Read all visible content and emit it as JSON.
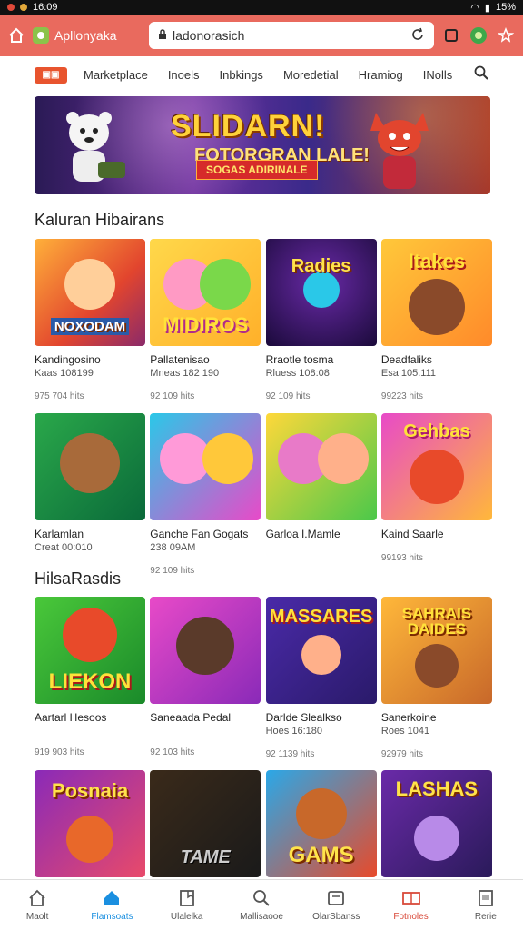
{
  "statusbar": {
    "time": "16:09",
    "battery": "15%"
  },
  "browser": {
    "app_name": "Apllonyaka",
    "url": "ladonorasich"
  },
  "nav": {
    "items": [
      "Marketplace",
      "Inoels",
      "Inbkings",
      "Moredetial",
      "Hramiog",
      "INolls"
    ]
  },
  "banner": {
    "title": "SLIDARN!",
    "subtitle": "FOTORGRAN LALE!",
    "tag": "SOGAS ADIRINALE"
  },
  "sections": [
    {
      "title": "Kaluran Hibairans",
      "cards": [
        {
          "art": "NOXODAM",
          "name": "Kandingosino",
          "meta": "Kaas 108199",
          "stat": "975 704 hits"
        },
        {
          "art": "MIDIROS",
          "name": "Pallatenisao",
          "meta": "Mneas 182 190",
          "stat": "92 109 hits"
        },
        {
          "art": "Radies",
          "name": "Rraotle tosma",
          "meta": "Rluess 108:08",
          "stat": "92 109 hits"
        },
        {
          "art": "Itakes",
          "name": "Deadfaliks",
          "meta": "Esa 105.111",
          "stat": "99223 hits"
        },
        {
          "art": "",
          "name": "Karlamlan",
          "meta": "Creat 00:010",
          "stat": ""
        },
        {
          "art": "",
          "name": "Ganche Fan Gogats",
          "meta": "238 09AM",
          "stat": "92 109 hits"
        },
        {
          "art": "",
          "name": "Garloa I.Mamle",
          "meta": "",
          "stat": ""
        },
        {
          "art": "Gehbas",
          "name": "Kaind Saarle",
          "meta": "",
          "stat": "99193 hits"
        }
      ]
    },
    {
      "title": "HilsaRasdis",
      "cards": [
        {
          "art": "LIEKON",
          "name": "Aartarl Hesoos",
          "meta": "",
          "stat": "919 903 hits"
        },
        {
          "art": "",
          "name": "Saneaada Pedal",
          "meta": "",
          "stat": "92 103 hits"
        },
        {
          "art": "MASSARES",
          "name": "Darlde Slealkso",
          "meta": "Hoes 16:180",
          "stat": "92 1139 hits"
        },
        {
          "art": "SAHRAIS DAIDES",
          "name": "Sanerkoine",
          "meta": "Roes 1041",
          "stat": "92979 hits"
        },
        {
          "art": "Posnaia",
          "name": "",
          "meta": "",
          "stat": ""
        },
        {
          "art": "TAME",
          "name": "",
          "meta": "",
          "stat": ""
        },
        {
          "art": "GAMS",
          "name": "",
          "meta": "",
          "stat": ""
        },
        {
          "art": "LASHAS",
          "name": "",
          "meta": "",
          "stat": ""
        }
      ]
    }
  ],
  "bottomnav": [
    "Maolt",
    "Flamsoats",
    "Ulalelka",
    "Mallisaooe",
    "OlarSbanss",
    "Fotnoles",
    "Rerie"
  ]
}
